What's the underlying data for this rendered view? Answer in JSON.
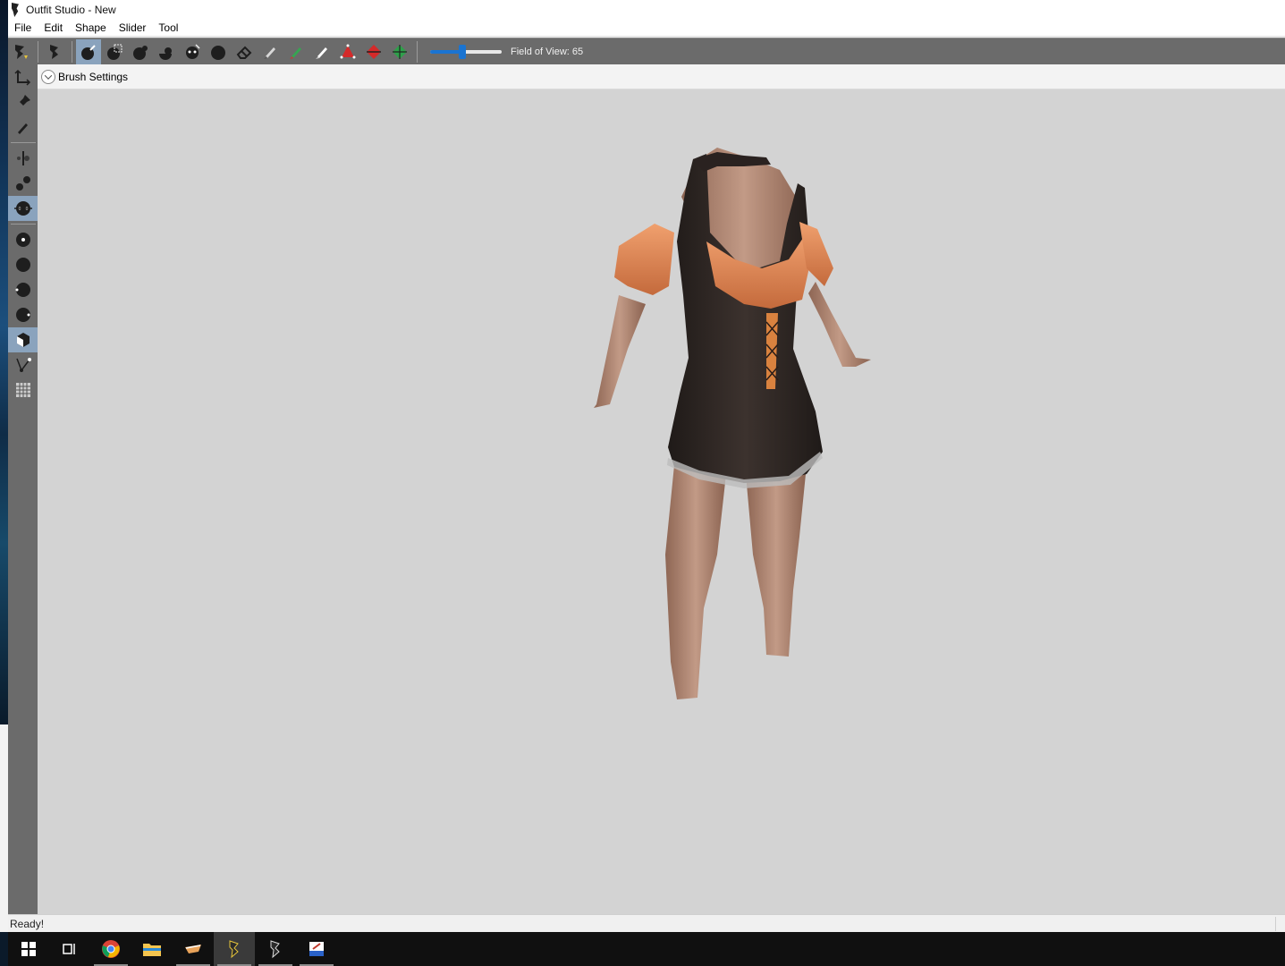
{
  "window": {
    "title": "Outfit Studio - New"
  },
  "menu": {
    "items": [
      "File",
      "Edit",
      "Shape",
      "Slider",
      "Tool"
    ]
  },
  "toolbar": {
    "buttons": [
      "outfit-studio-logo-icon",
      "skyrim-logo-icon",
      "select-brush-icon",
      "mask-brush-icon",
      "inflate-brush-icon",
      "deflate-brush-icon",
      "move-brush-icon",
      "smooth-brush-icon",
      "undiff-brush-icon",
      "eraser-icon",
      "weight-paint-icon",
      "color-paint-icon",
      "alpha-paint-icon",
      "transform-icon",
      "pivot-icon",
      "vertex-select-icon"
    ],
    "fov_label": "Field of View: 65",
    "fov_value": 65,
    "slider_fraction": 0.45
  },
  "left_tools": [
    "select-icon",
    "pin-icon",
    "pen-icon",
    "transform-line-icon",
    "connect-icon",
    "expand-brush-icon",
    "sphere-1-icon",
    "sphere-2-icon",
    "sphere-3-icon",
    "sphere-4-icon",
    "cube-icon",
    "vertex-edge-icon",
    "grid-icon"
  ],
  "brush_settings": {
    "label": "Brush Settings"
  },
  "status": {
    "text": "Ready!"
  },
  "taskbar": {
    "items": [
      "windows-start-icon",
      "task-view-icon",
      "chrome-icon",
      "file-explorer-icon",
      "app-bowl-icon",
      "outfit-studio-icon",
      "outfit-studio-icon-2",
      "paint-app-icon"
    ]
  },
  "colors": {
    "toolbar_bg": "#6b6b6b",
    "active_tool": "#8aa3bd",
    "viewport_bg": "#d3d3d3",
    "slider_accent": "#1a74d2",
    "dress_dark": "#2f2724",
    "dress_orange": "#e48a58",
    "skin": "#b58670"
  }
}
